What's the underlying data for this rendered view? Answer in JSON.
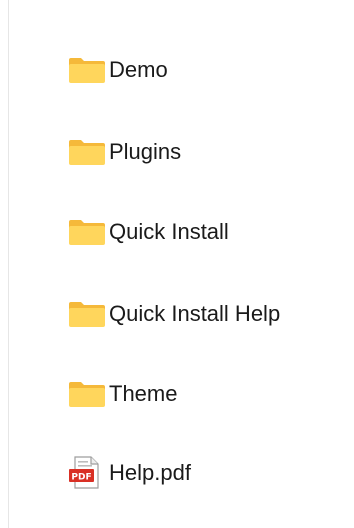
{
  "items": [
    {
      "name": "Demo",
      "type": "folder",
      "icon": "folder-icon"
    },
    {
      "name": "Plugins",
      "type": "folder",
      "icon": "folder-icon"
    },
    {
      "name": "Quick Install",
      "type": "folder",
      "icon": "folder-icon"
    },
    {
      "name": "Quick Install Help",
      "type": "folder",
      "icon": "folder-icon"
    },
    {
      "name": "Theme",
      "type": "folder",
      "icon": "folder-icon"
    },
    {
      "name": "Help.pdf",
      "type": "pdf",
      "icon": "pdf-file-icon"
    }
  ],
  "colors": {
    "folder_front": "#FFD65C",
    "folder_back": "#F5B93A",
    "pdf_red": "#D93025",
    "text": "#1a1a1a"
  }
}
